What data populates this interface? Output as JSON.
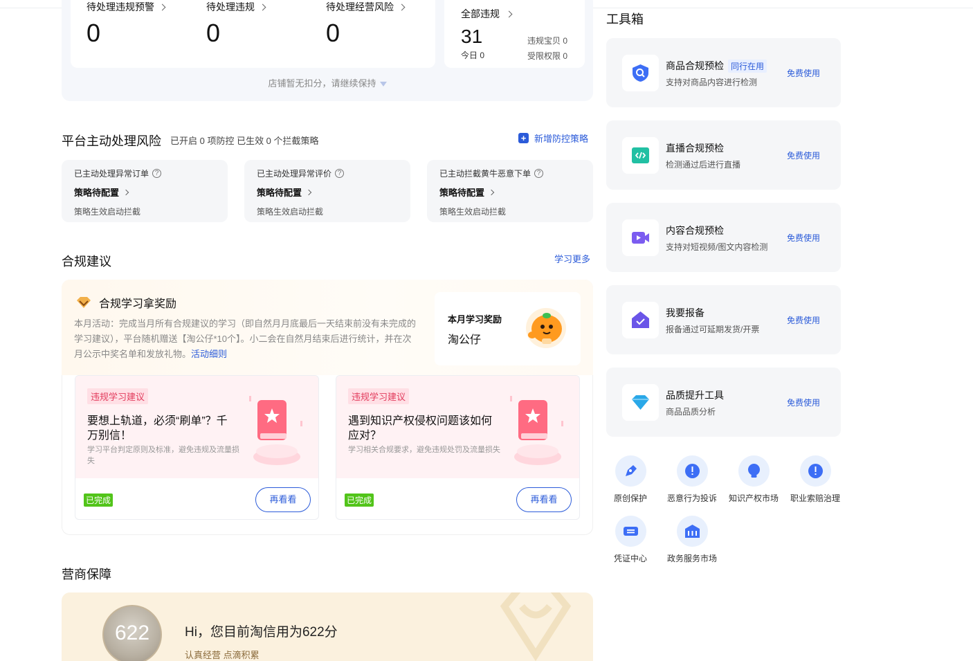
{
  "stats": {
    "pending_warning": {
      "label": "待处理违规预警",
      "value": "0"
    },
    "pending_violation": {
      "label": "待处理违规",
      "value": "0"
    },
    "pending_risk": {
      "label": "待处理经营风险",
      "value": "0"
    },
    "all": {
      "label": "全部违规",
      "value": "31",
      "today": "今日 0",
      "treasure": "违规宝贝 0",
      "restricted": "受限权限 0"
    },
    "hint": "店铺暂无扣分，请继续保持"
  },
  "platform_risk": {
    "title": "平台主动处理风险",
    "subtitle": "已开启 0 项防控 已生效 0 个拦截策略",
    "add": "新增防控策略",
    "cards": [
      {
        "title": "已主动处理异常订单",
        "status": "策略待配置",
        "desc": "策略生效启动拦截"
      },
      {
        "title": "已主动处理异常评价",
        "status": "策略待配置",
        "desc": "策略生效启动拦截"
      },
      {
        "title": "已主动拦截黄牛恶意下单",
        "status": "策略待配置",
        "desc": "策略生效启动拦截"
      }
    ]
  },
  "compliance": {
    "title": "合规建议",
    "learn_more": "学习更多",
    "reward_title": "合规学习拿奖励",
    "reward_desc": "本月活动：完成当月所有合规建议的学习（即自然月月底最后一天结束前没有未完成的学习建议），平台随机赠送【淘公仔*10个】。小二会在自然月结束后进行统计，并在次月公示中奖名单和发放礼物。",
    "reward_link": "活动细则",
    "month_reward_label": "本月学习奖励",
    "month_reward_item": "淘公仔",
    "lessons": [
      {
        "tag": "违规学习建议",
        "title": "要想上轨道，必须“刷单”？千万别信！",
        "desc": "学习平台判定原则及标准，避免违规及流量损失",
        "status": "已完成",
        "button": "再看看"
      },
      {
        "tag": "违规学习建议",
        "title": "遇到知识产权侵权问题该如何应对？",
        "desc": "学习相关合规要求，避免违规处罚及流量损失",
        "status": "已完成",
        "button": "再看看"
      }
    ]
  },
  "guarantee": {
    "title": "营商保障",
    "score": "622",
    "greeting": "Hi，您目前淘信用为622分",
    "motto": "认真经营 点滴积累"
  },
  "toolbox": {
    "title": "工具箱",
    "tools": [
      {
        "name": "商品合规预检",
        "badge": "同行在用",
        "desc": "支持对商品内容进行检测",
        "action": "免费使用",
        "icon": "shield-search-icon",
        "color": "#3d6ef5"
      },
      {
        "name": "直播合规预检",
        "badge": "",
        "desc": "检测通过后进行直播",
        "action": "免费使用",
        "icon": "code-icon",
        "color": "#22c0a3"
      },
      {
        "name": "内容合规预检",
        "badge": "",
        "desc": "支持对短视频/图文内容检测",
        "action": "免费使用",
        "icon": "video-icon",
        "color": "#7b5cf0"
      },
      {
        "name": "我要报备",
        "badge": "",
        "desc": "报备通过可延期发货/开票",
        "action": "免费使用",
        "icon": "house-check-icon",
        "color": "#6a55e8"
      },
      {
        "name": "品质提升工具",
        "badge": "",
        "desc": "商品品质分析",
        "action": "免费使用",
        "icon": "diamond-icon",
        "color": "#2aa8e8"
      }
    ],
    "quick": [
      {
        "label": "原创保护",
        "icon": "pen-icon"
      },
      {
        "label": "恶意行为投诉",
        "icon": "alert-icon"
      },
      {
        "label": "知识产权市场",
        "icon": "bulb-icon"
      },
      {
        "label": "职业索赔治理",
        "icon": "alert-icon"
      },
      {
        "label": "凭证中心",
        "icon": "ticket-icon"
      },
      {
        "label": "政务服务市场",
        "icon": "building-icon"
      }
    ]
  }
}
